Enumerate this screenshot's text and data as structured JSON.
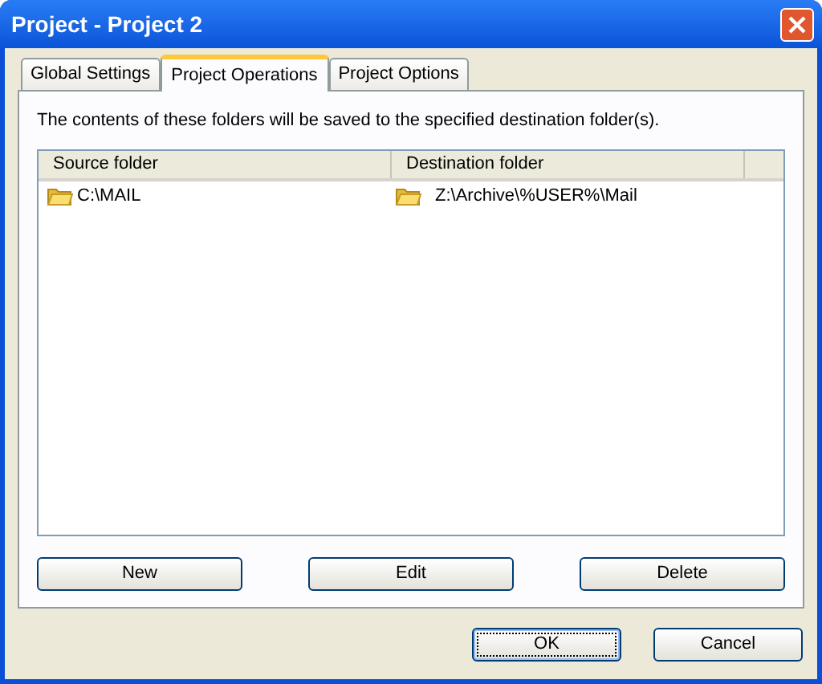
{
  "window": {
    "title": "Project - Project 2"
  },
  "tabs": [
    {
      "label": "Global Settings",
      "selected": false
    },
    {
      "label": "Project Operations",
      "selected": true
    },
    {
      "label": "Project Options",
      "selected": false
    }
  ],
  "description": "The contents of these folders will be saved to the specified destination folder(s).",
  "table": {
    "columns": [
      "Source folder",
      "Destination folder"
    ],
    "rows": [
      {
        "source": "C:\\MAIL",
        "destination": "Z:\\Archive\\%USER%\\Mail",
        "selected": false
      }
    ]
  },
  "list_buttons": [
    "New",
    "Edit",
    "Delete"
  ],
  "dialog_buttons": [
    {
      "label": "OK",
      "default": true
    },
    {
      "label": "Cancel",
      "default": false
    }
  ]
}
